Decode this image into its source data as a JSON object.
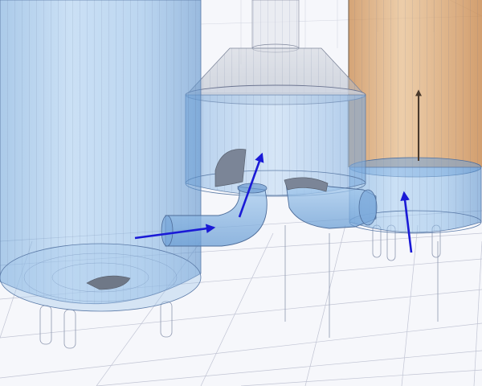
{
  "scene": {
    "colors": {
      "background": "#f7f8fc",
      "grid_line": "#b9bccd",
      "wire": "#6b7da0",
      "vessel_blue": "#8fbde6",
      "vessel_blue_dark": "#5b8fc9",
      "vessel_orange": "#d9a36a",
      "hood_grey": "#b8bec9",
      "baffle": "#7d8796",
      "flow_arrow": "#1a1ad6",
      "rising_arrow": "#5a4a3a"
    },
    "components": [
      {
        "id": "left-vessel",
        "kind": "cylindrical vessel"
      },
      {
        "id": "center-vessel",
        "kind": "cylindrical vessel with conical hood"
      },
      {
        "id": "right-vessel",
        "kind": "cylindrical vessel with amber upper section"
      },
      {
        "id": "left-elbow-pipe",
        "kind": "inlet elbow pipe"
      },
      {
        "id": "center-elbow-pipe",
        "kind": "transfer elbow pipe"
      }
    ],
    "flow_arrows": [
      {
        "id": "inlet-flow",
        "color": "blue"
      },
      {
        "id": "elbow-rise-flow",
        "color": "blue"
      },
      {
        "id": "right-inlet-flow",
        "color": "blue"
      },
      {
        "id": "updraft",
        "color": "dark-brown"
      }
    ]
  }
}
